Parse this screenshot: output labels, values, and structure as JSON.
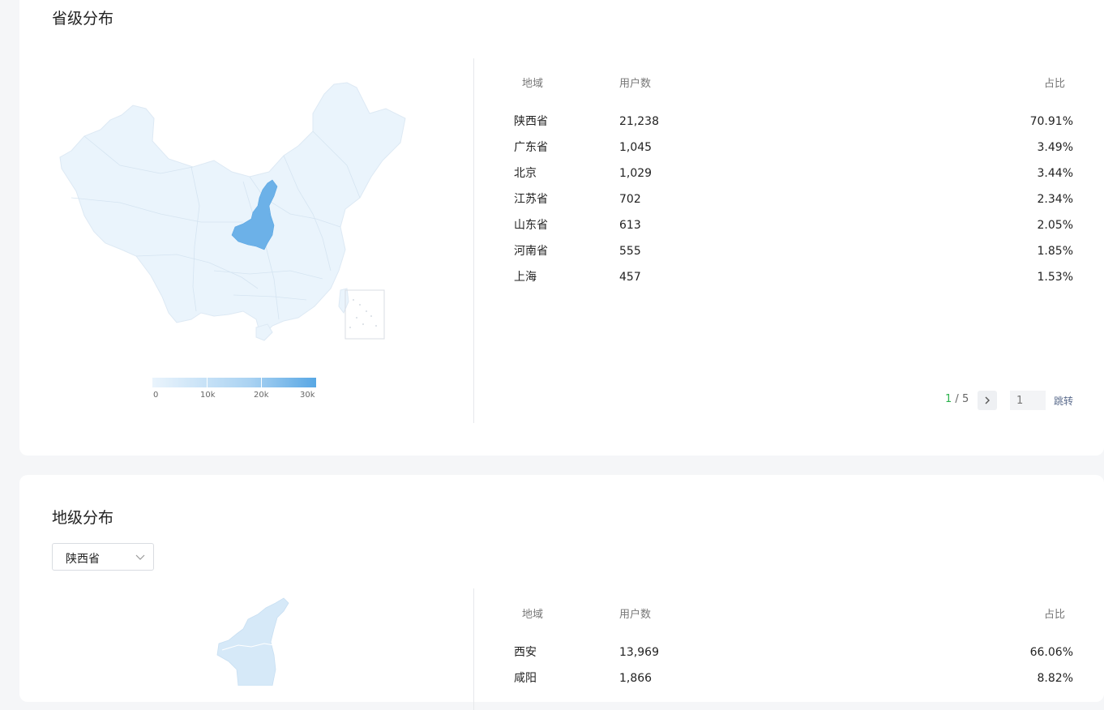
{
  "province_section": {
    "title": "省级分布",
    "legend_ticks": [
      "0",
      "10k",
      "20k",
      "30k"
    ],
    "table": {
      "headers": {
        "region": "地域",
        "users": "用户数",
        "share": "占比"
      },
      "rows": [
        {
          "region": "陕西省",
          "users": "21,238",
          "share": "70.91%"
        },
        {
          "region": "广东省",
          "users": "1,045",
          "share": "3.49%"
        },
        {
          "region": "北京",
          "users": "1,029",
          "share": "3.44%"
        },
        {
          "region": "江苏省",
          "users": "702",
          "share": "2.34%"
        },
        {
          "region": "山东省",
          "users": "613",
          "share": "2.05%"
        },
        {
          "region": "河南省",
          "users": "555",
          "share": "1.85%"
        },
        {
          "region": "上海",
          "users": "457",
          "share": "1.53%"
        }
      ]
    },
    "pager": {
      "current": "1",
      "separator": " / ",
      "total": "5",
      "next_icon": "chevron-right-icon",
      "jump_placeholder": "1",
      "jump_label": "跳转"
    },
    "colors": {
      "map_base": "#eaf4fc",
      "map_highlight": "#6cb1e8",
      "pager_current": "#2bb24c"
    }
  },
  "city_section": {
    "title": "地级分布",
    "province_select": {
      "value": "陕西省",
      "icon": "chevron-down-icon"
    },
    "table": {
      "headers": {
        "region": "地域",
        "users": "用户数",
        "share": "占比"
      },
      "rows": [
        {
          "region": "西安",
          "users": "13,969",
          "share": "66.06%"
        },
        {
          "region": "咸阳",
          "users": "1,866",
          "share": "8.82%"
        }
      ]
    }
  }
}
